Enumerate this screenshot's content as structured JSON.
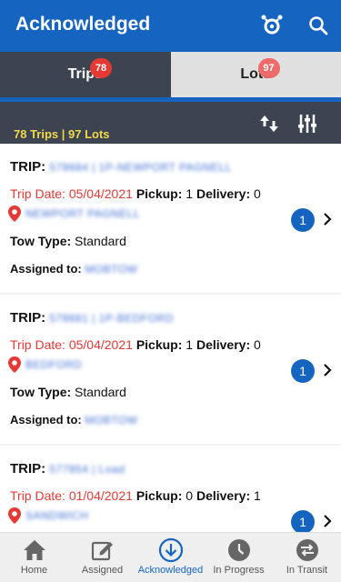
{
  "header": {
    "title": "Acknowledged",
    "filter_icon": "accessibility-icon",
    "search_icon": "search-icon"
  },
  "tabs": [
    {
      "label": "Trips",
      "badge": "78",
      "active": true
    },
    {
      "label": "Lots",
      "badge": "97",
      "active": false
    }
  ],
  "summary": {
    "text": "78 Trips | 97 Lots"
  },
  "labels": {
    "trip": "TRIP:",
    "trip_date": "Trip Date:",
    "pickup": "Pickup:",
    "delivery": "Delivery:",
    "tow_type": "Tow Type:",
    "assigned_to": "Assigned to:"
  },
  "trips": [
    {
      "id": "578684 | 1P-NEWPORT PAGNELL",
      "date": "05/04/2021",
      "pickup": "1",
      "delivery": "0",
      "location": "NEWPORT PAGNELL",
      "tow_type": "Standard",
      "assigned": "MOBTOW",
      "count": "1"
    },
    {
      "id": "578681 | 1P-BEDFORD",
      "date": "05/04/2021",
      "pickup": "1",
      "delivery": "0",
      "location": "BEDFORD",
      "tow_type": "Standard",
      "assigned": "MOBTOW",
      "count": "1"
    },
    {
      "id": "577854 | Load",
      "date": "01/04/2021",
      "pickup": "0",
      "delivery": "1",
      "location": "SANDWICH",
      "tow_type": "",
      "assigned": "",
      "count": "1"
    }
  ],
  "nav": [
    {
      "label": "Home",
      "icon": "home-icon",
      "active": false
    },
    {
      "label": "Assigned",
      "icon": "edit-icon",
      "active": false
    },
    {
      "label": "Acknowledged",
      "icon": "download-circle-icon",
      "active": true
    },
    {
      "label": "In Progress",
      "icon": "clock-icon",
      "active": false
    },
    {
      "label": "In Transit",
      "icon": "swap-icon",
      "active": false
    }
  ],
  "colors": {
    "primary": "#1565c0",
    "dark": "#3c4452",
    "accent_yellow": "#f2d84a",
    "red": "#e53935"
  }
}
